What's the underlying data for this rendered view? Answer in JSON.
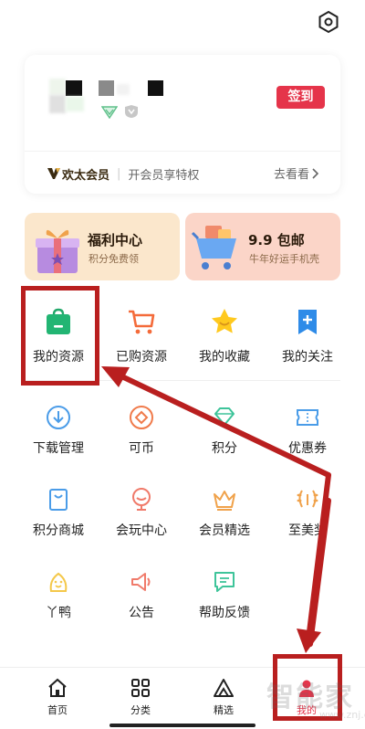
{
  "profile": {
    "checkin_label": "签到",
    "vip_name": "欢太会员",
    "vip_tagline": "开会员享特权",
    "vip_link": "去看看"
  },
  "promos": [
    {
      "title": "福利中心",
      "subtitle": "积分免费领"
    },
    {
      "title": "9.9 包邮",
      "subtitle": "牛年好运手机壳"
    }
  ],
  "top_grid": [
    {
      "label": "我的资源",
      "icon": "resource-bag-icon"
    },
    {
      "label": "已购资源",
      "icon": "shopping-cart-icon"
    },
    {
      "label": "我的收藏",
      "icon": "star-icon"
    },
    {
      "label": "我的关注",
      "icon": "bookmark-plus-icon"
    }
  ],
  "service_grid": [
    {
      "label": "下载管理",
      "icon": "download-icon"
    },
    {
      "label": "可币",
      "icon": "coin-icon"
    },
    {
      "label": "积分",
      "icon": "diamond-icon"
    },
    {
      "label": "优惠券",
      "icon": "ticket-icon"
    },
    {
      "label": "积分商城",
      "icon": "store-bag-icon"
    },
    {
      "label": "会玩中心",
      "icon": "game-badge-icon"
    },
    {
      "label": "会员精选",
      "icon": "crown-icon"
    },
    {
      "label": "至美奖",
      "icon": "laurel-icon"
    },
    {
      "label": "丫鸭",
      "icon": "duck-icon"
    },
    {
      "label": "公告",
      "icon": "megaphone-icon"
    },
    {
      "label": "帮助反馈",
      "icon": "feedback-icon"
    }
  ],
  "tabbar": [
    {
      "label": "首页",
      "icon": "home-icon"
    },
    {
      "label": "分类",
      "icon": "grid-icon"
    },
    {
      "label": "精选",
      "icon": "triangle-icon"
    },
    {
      "label": "我的",
      "icon": "person-icon"
    }
  ],
  "watermark": {
    "text": "智能家",
    "url": "www.znj.com"
  },
  "colors": {
    "accent": "#e5344a",
    "annotation": "#b91f1f"
  }
}
